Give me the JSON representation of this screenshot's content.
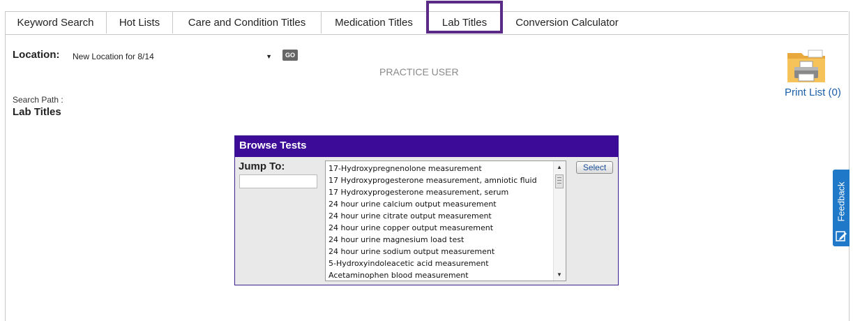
{
  "tabs": [
    {
      "label": "Keyword Search"
    },
    {
      "label": "Hot Lists"
    },
    {
      "label": "Care and Condition Titles"
    },
    {
      "label": "Medication Titles"
    },
    {
      "label": "Lab Titles",
      "active": true
    },
    {
      "label": "Conversion Calculator"
    }
  ],
  "location": {
    "label": "Location:",
    "selected": "New Location for 8/14",
    "go_label": "GO"
  },
  "user_name": "PRACTICE USER",
  "search_path": {
    "label": "Search Path :",
    "value": "Lab Titles"
  },
  "print_list": {
    "label": "Print List (0)",
    "icon": "printer-folder-icon"
  },
  "feedback": {
    "label": "Feedback",
    "icon": "feedback-edit-icon"
  },
  "browse": {
    "title": "Browse Tests",
    "jump_label": "Jump To:",
    "jump_value": "",
    "select_label": "Select",
    "items": [
      "17-Hydroxypregnenolone measurement",
      "17 Hydroxyprogesterone measurement, amniotic fluid",
      "17 Hydroxyprogesterone measurement, serum",
      "24 hour urine calcium output measurement",
      "24 hour urine citrate output measurement",
      "24 hour urine copper output measurement",
      "24 hour urine magnesium load test",
      "24 hour urine sodium output measurement",
      "5-Hydroxyindoleacetic acid measurement",
      "Acetaminophen blood measurement"
    ]
  },
  "colors": {
    "active_tab_outline": "#5b2a86",
    "browse_header": "#3c0c98",
    "feedback_bg": "#1f78c8",
    "link": "#1a5fa8"
  }
}
